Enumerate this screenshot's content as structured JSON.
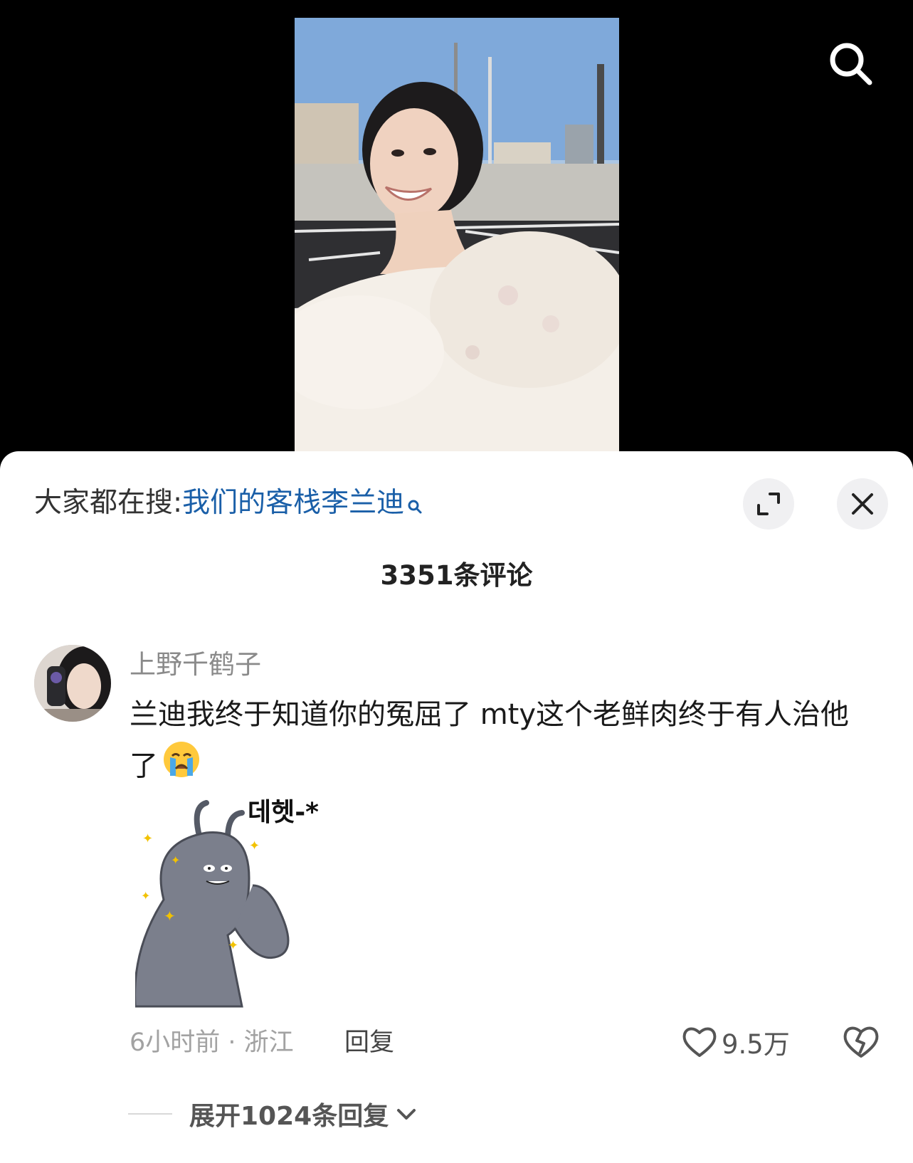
{
  "header": {
    "search_icon": "search-icon"
  },
  "hot_search": {
    "prefix": "大家都在搜:",
    "query": "我们的客栈李兰迪",
    "query_icon": "search-icon"
  },
  "actions": {
    "expand_icon": "expand-icon",
    "close_icon": "close-icon"
  },
  "comments_header": {
    "count_label": "3351条评论"
  },
  "comment": {
    "username": "上野千鹤子",
    "text": "兰迪我终于知道你的冤屈了 mty这个老鲜肉终于有人治他了",
    "emoji": "crying-face-emoji",
    "sticker_text": "데헷-*",
    "time_location": "6小时前 · 浙江",
    "reply_label": "回复",
    "like_count": "9.5万",
    "like_icon": "heart-icon",
    "dislike_icon": "broken-heart-icon"
  },
  "expand_replies": {
    "label": "展开1024条回复",
    "icon": "chevron-down-icon"
  },
  "colors": {
    "link_blue": "#1a5fa8",
    "page_bg": "#000000",
    "sheet_bg": "#ffffff",
    "muted_text": "#a2a2a2"
  }
}
